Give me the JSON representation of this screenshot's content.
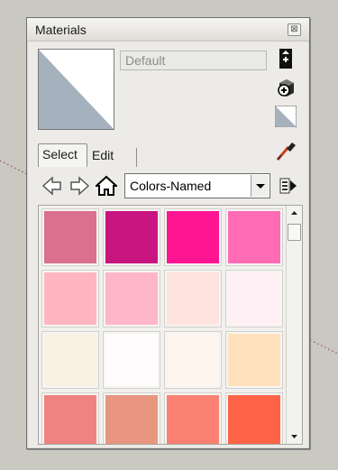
{
  "window": {
    "title": "Materials",
    "close_glyph": "⊠"
  },
  "material": {
    "name": "Default",
    "preview_colors": {
      "light": "#ffffff",
      "dark": "#a5b2bd"
    }
  },
  "side_icons": [
    "display-in-model-icon",
    "create-material-icon",
    "default-material-icon"
  ],
  "tabs": [
    {
      "label": "Select",
      "active": true
    },
    {
      "label": "Edit",
      "active": false
    }
  ],
  "eyedropper_icon": "sample-paint-icon",
  "toolbar": {
    "icons": [
      "back-arrow-icon",
      "forward-arrow-icon",
      "home-icon"
    ],
    "collection": "Colors-Named",
    "details_icon": "details-arrow-icon"
  },
  "swatches": [
    "#d8708e",
    "#c81580",
    "#ff1592",
    "#ff6bb5",
    "#ffb6c1",
    "#ffb6c8",
    "#ffe3df",
    "#fff0f5",
    "#faf1e5",
    "#fefcfc",
    "#fff5ef",
    "#ffe2bd",
    "#f08281",
    "#e89680",
    "#fa8172",
    "#ff6347"
  ],
  "colors": {
    "panel_bg": "#ecebe7",
    "desktop_bg": "#c9c9c1",
    "guide_line": "#a04a5a"
  }
}
